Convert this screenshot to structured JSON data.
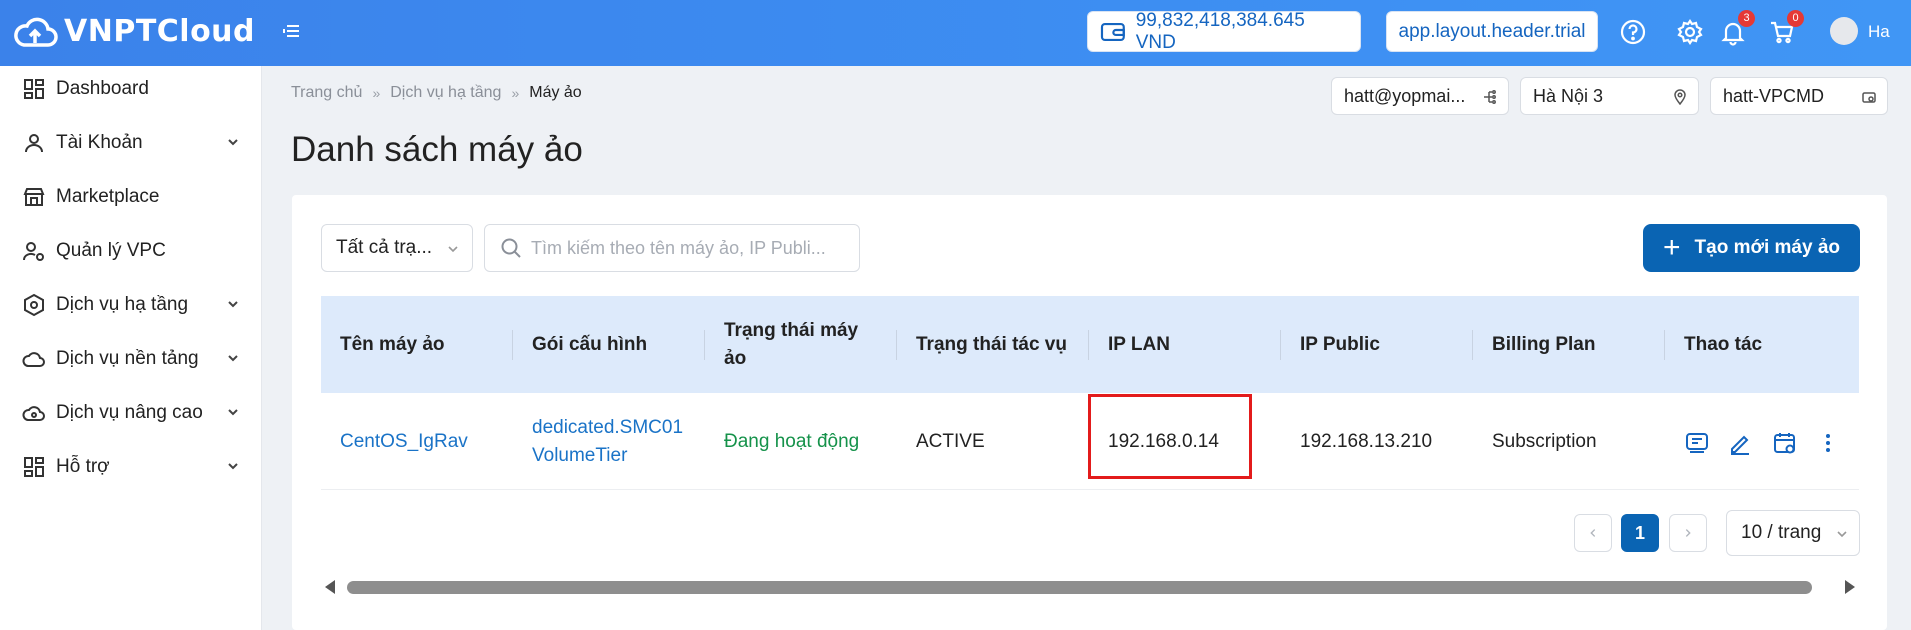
{
  "header": {
    "brand": "VNPTCloud",
    "balance": "99,832,418,384.645 VND",
    "trial_label": "app.layout.header.trial",
    "notification_count": "3",
    "cart_count": "0",
    "user_name": "Ha"
  },
  "sidebar": {
    "items": [
      {
        "label": "Dashboard",
        "icon": "dashboard-icon"
      },
      {
        "label": "Tài Khoản",
        "icon": "user-icon"
      },
      {
        "label": "Marketplace",
        "icon": "store-icon"
      },
      {
        "label": "Quản lý VPC",
        "icon": "user-cog-icon"
      },
      {
        "label": "Dịch vụ hạ tầng",
        "icon": "hexagon-icon"
      },
      {
        "label": "Dịch vụ nền tảng",
        "icon": "cloud-icon"
      },
      {
        "label": "Dịch vụ nâng cao",
        "icon": "cloud-cog-icon"
      },
      {
        "label": "Hỗ trợ",
        "icon": "grid-icon"
      }
    ]
  },
  "breadcrumb": {
    "items": [
      "Trang chủ",
      "Dịch vụ hạ tầng",
      "Máy ảo"
    ]
  },
  "page": {
    "title": "Danh sách máy ảo"
  },
  "context": {
    "account": "hatt@yopmai...",
    "region": "Hà Nội 3",
    "project": "hatt-VPCMD"
  },
  "toolbar": {
    "status_filter": "Tất cả trạ...",
    "search_placeholder": "Tìm kiếm theo tên máy ảo, IP Publi...",
    "create_label": "Tạo mới máy ảo"
  },
  "table": {
    "columns": [
      "Tên máy ảo",
      "Gói cấu hình",
      "Trạng thái máy ảo",
      "Trạng thái tác vụ",
      "IP LAN",
      "IP Public",
      "Billing Plan",
      "Thao tác"
    ],
    "rows": [
      {
        "name": "CentOS_IgRav",
        "package_line1": "dedicated.SMC01",
        "package_line2": "VolumeTier",
        "vm_status": "Đang hoạt động",
        "task_status": "ACTIVE",
        "ip_lan": "192.168.0.14",
        "ip_public": "192.168.13.210",
        "billing_plan": "Subscription"
      }
    ]
  },
  "pagination": {
    "current_page": "1",
    "page_size": "10 / trang"
  },
  "colors": {
    "primary": "#0a64b3",
    "header": "#3b82ea",
    "link": "#1a73c7",
    "status_active": "#15924a",
    "highlight": "#e31b1b"
  }
}
